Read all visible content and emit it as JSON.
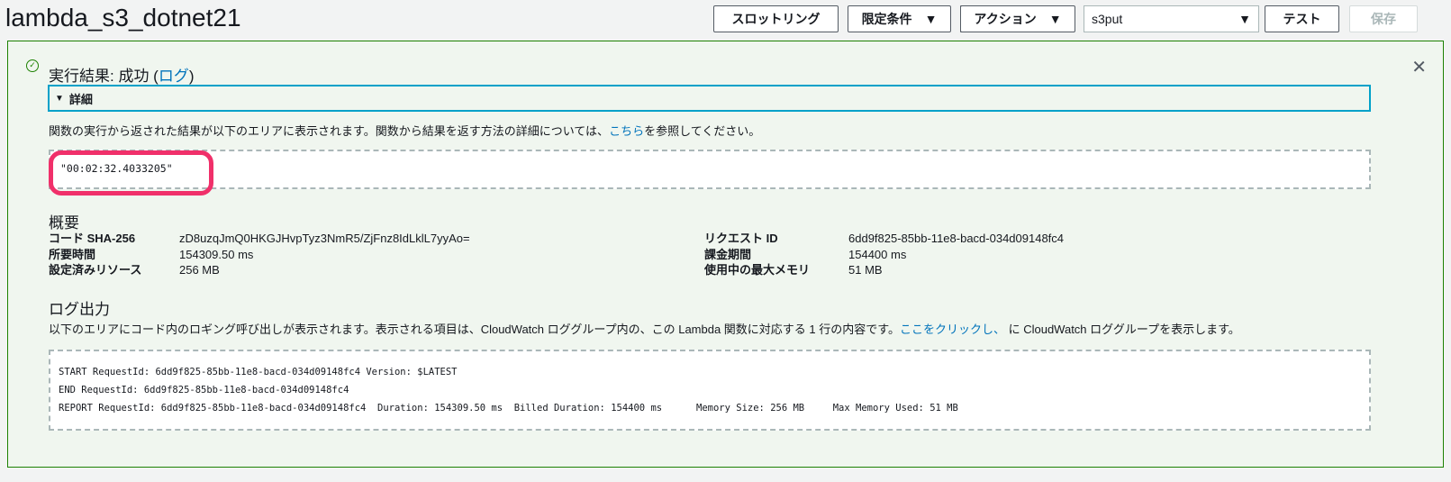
{
  "header": {
    "title": "lambda_s3_dotnet21",
    "throttle": "スロットリング",
    "qualifiers": "限定条件",
    "actions": "アクション",
    "test_event": "s3put",
    "test": "テスト",
    "save": "保存"
  },
  "result": {
    "title_prefix": "実行結果: 成功 (",
    "log_link": "ログ",
    "title_suffix": ")",
    "details": "詳細",
    "desc_before": "関数の実行から返された結果が以下のエリアに表示されます。関数から結果を返す方法の詳細については、",
    "desc_link": "こちら",
    "desc_after": "を参照してください。",
    "output": "\"00:02:32.4033205\""
  },
  "summary": {
    "heading": "概要",
    "left": [
      {
        "k": "コード SHA-256",
        "v": "zD8uzqJmQ0HKGJHvpTyz3NmR5/ZjFnz8IdLklL7yyAo="
      },
      {
        "k": "所要時間",
        "v": "154309.50 ms"
      },
      {
        "k": "設定済みリソース",
        "v": "256 MB"
      }
    ],
    "right": [
      {
        "k": "リクエスト ID",
        "v": "6dd9f825-85bb-11e8-bacd-034d09148fc4"
      },
      {
        "k": "課金期間",
        "v": "154400 ms"
      },
      {
        "k": "使用中の最大メモリ",
        "v": "51 MB"
      }
    ]
  },
  "log": {
    "heading": "ログ出力",
    "desc_before": "以下のエリアにコード内のロギング呼び出しが表示されます。表示される項目は、CloudWatch ロググループ内の、この Lambda 関数に対応する 1 行の内容です。",
    "desc_link": "ここをクリックし、",
    "desc_after": " に CloudWatch ロググループを表示します。",
    "lines": [
      "START RequestId: 6dd9f825-85bb-11e8-bacd-034d09148fc4 Version: $LATEST",
      "END RequestId: 6dd9f825-85bb-11e8-bacd-034d09148fc4",
      "REPORT RequestId: 6dd9f825-85bb-11e8-bacd-034d09148fc4  Duration: 154309.50 ms  Billed Duration: 154400 ms      Memory Size: 256 MB     Max Memory Used: 51 MB"
    ]
  }
}
